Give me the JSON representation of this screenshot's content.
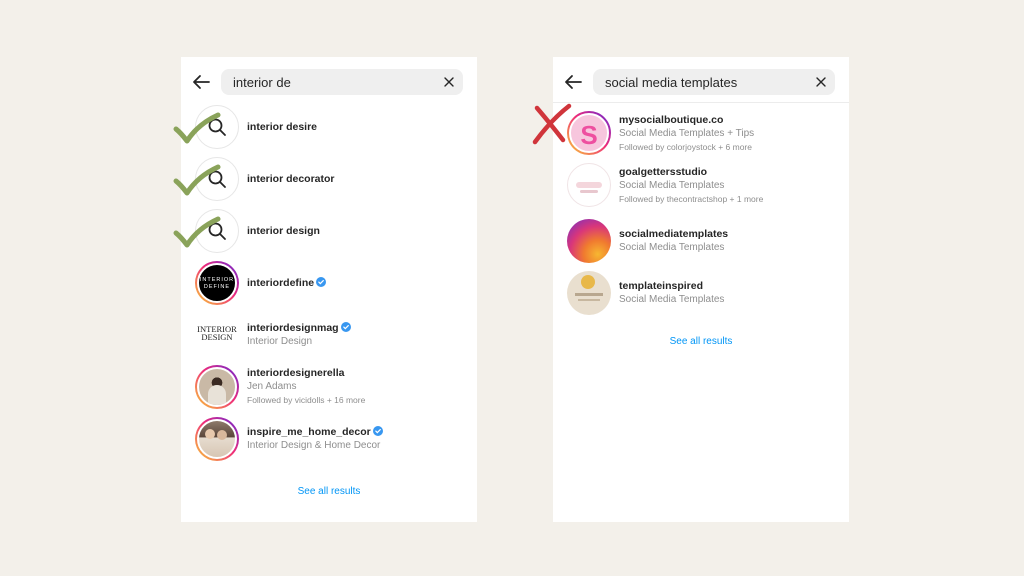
{
  "colors": {
    "background": "#f3f0ea",
    "link": "#0095f6",
    "check": "#8aa35a",
    "cross": "#d0353b",
    "verified": "#3897f0"
  },
  "left": {
    "query": "interior de",
    "suggestions": [
      {
        "label": "interior desire",
        "icon": "search-icon",
        "marked": "check"
      },
      {
        "label": "interior decorator",
        "icon": "search-icon",
        "marked": "check"
      },
      {
        "label": "interior design",
        "icon": "search-icon",
        "marked": "check"
      }
    ],
    "accounts": [
      {
        "username": "interiordefine",
        "verified": true,
        "avatar_text": "INTERIOR DEFINE"
      },
      {
        "username": "interiordesignmag",
        "verified": true,
        "subtitle": "Interior Design",
        "avatar_text": "INTERIOR DESIGN"
      },
      {
        "username": "interiordesignerella",
        "subtitle": "Jen Adams",
        "followed_by": "Followed by vicidolls + 16 more"
      },
      {
        "username": "inspire_me_home_decor",
        "verified": true,
        "subtitle": "Interior Design & Home Decor"
      }
    ],
    "see_all": "See all results"
  },
  "right": {
    "query": "social media templates",
    "accounts": [
      {
        "username": "mysocialboutique.co",
        "subtitle": "Social Media Templates + Tips",
        "followed_by": "Followed by colorjoystock + 6 more",
        "avatar_letter": "S",
        "marked": "cross"
      },
      {
        "username": "goalgettersstudio",
        "subtitle": "Social Media Templates",
        "followed_by": "Followed by thecontractshop + 1 more"
      },
      {
        "username": "socialmediatemplates",
        "subtitle": "Social Media Templates"
      },
      {
        "username": "templateinspired",
        "subtitle": "Social Media Templates"
      }
    ],
    "see_all": "See all results"
  }
}
